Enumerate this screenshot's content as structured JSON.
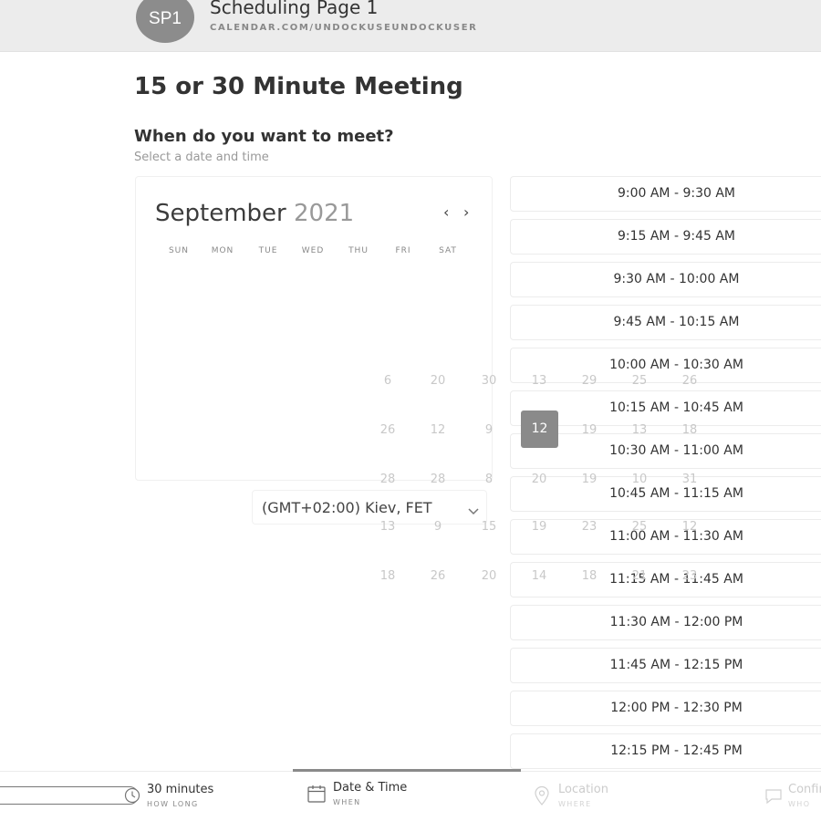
{
  "header": {
    "avatar_initials": "SP1",
    "title": "Scheduling Page 1",
    "url": "CALENDAR.COM/UNDOCKUSEUNDOCKUSER"
  },
  "main": {
    "title": "15 or 30 Minute Meeting",
    "question": "When do you want to meet?",
    "subtitle": "Select a date and time"
  },
  "calendar": {
    "month": "September",
    "year": "2021",
    "prev_glyph": "‹",
    "next_glyph": "›",
    "weekdays": [
      "SUN",
      "MON",
      "TUE",
      "WED",
      "THU",
      "FRI",
      "SAT"
    ],
    "visible_day_numbers": [
      "6",
      "20",
      "30",
      "13",
      "29",
      "25",
      "26",
      "26",
      "12",
      "9",
      "19",
      "13",
      "18",
      "28",
      "28",
      "8",
      "20",
      "19",
      "10",
      "31",
      "13",
      "9",
      "15",
      "19",
      "23",
      "25",
      "12",
      "18",
      "26",
      "20",
      "14",
      "18",
      "21",
      "23"
    ],
    "selected_day": "12"
  },
  "timezone": {
    "value": "(GMT+02:00) Kiev, FET"
  },
  "time_slots": [
    "9:00 AM - 9:30 AM",
    "9:15 AM - 9:45 AM",
    "9:30 AM - 10:00 AM",
    "9:45 AM - 10:15 AM",
    "10:00 AM - 10:30 AM",
    "10:15 AM - 10:45 AM",
    "10:30 AM - 11:00 AM",
    "10:45 AM - 11:15 AM",
    "11:00 AM - 11:30 AM",
    "11:15 AM - 11:45 AM",
    "11:30 AM - 12:00 PM",
    "11:45 AM - 12:15 PM",
    "12:00 PM - 12:30 PM",
    "12:15 PM - 12:45 PM"
  ],
  "steps": [
    {
      "label": "30 minutes",
      "sub": "HOW LONG",
      "icon": "clock-icon"
    },
    {
      "label": "Date & Time",
      "sub": "WHEN",
      "icon": "calendar-icon"
    },
    {
      "label": "Location",
      "sub": "WHERE",
      "icon": "location-pin-icon"
    },
    {
      "label": "Confirm",
      "sub": "WHO",
      "icon": "chat-icon"
    }
  ],
  "colors": {
    "header_bg": "#ececec",
    "avatar_bg": "#8c8c8c",
    "selected_day_bg": "#8a8a8a",
    "active_step_line": "#8a8a8a"
  }
}
